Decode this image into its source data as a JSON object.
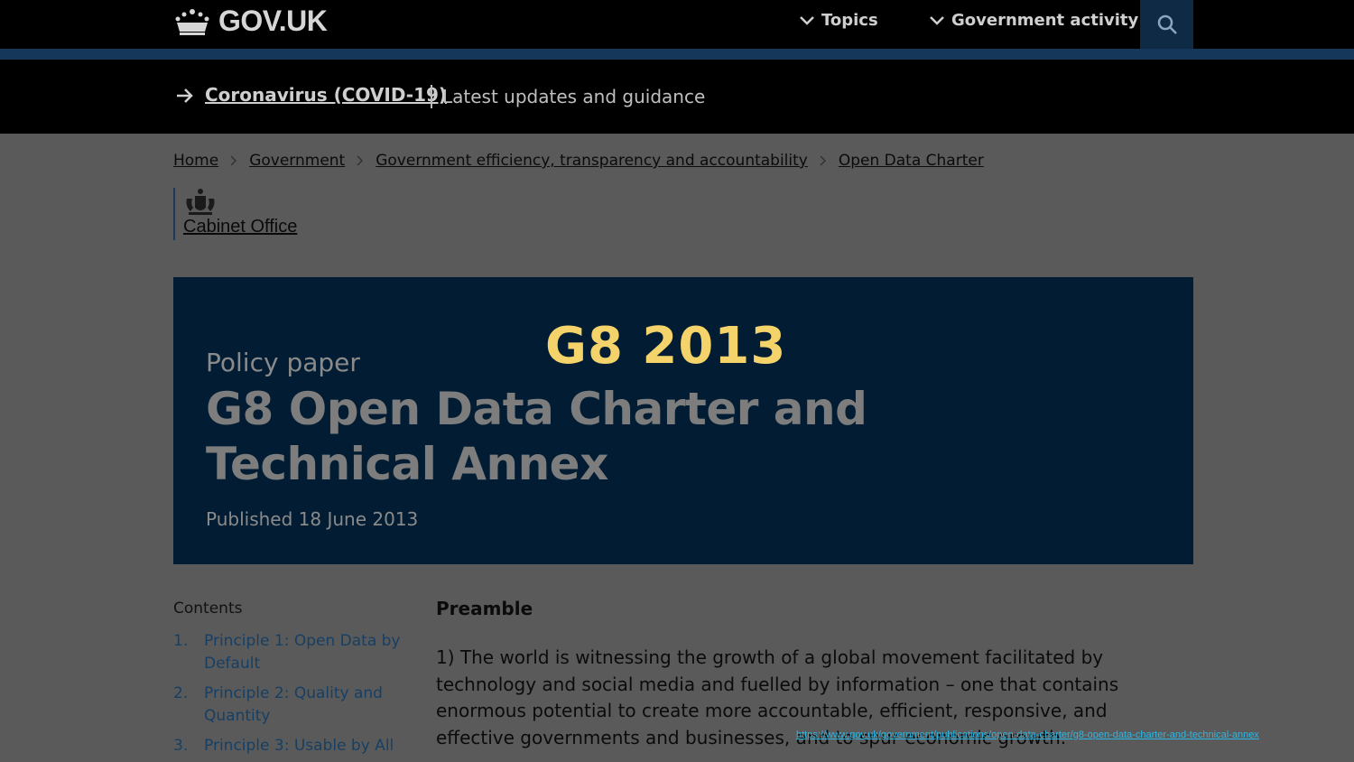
{
  "header": {
    "logo_text": "GOV.UK",
    "nav": [
      {
        "label": "Topics"
      },
      {
        "label": "Government activity"
      }
    ]
  },
  "covid_banner": {
    "link": "Coronavirus (COVID-19)",
    "text": "Latest updates and guidance"
  },
  "breadcrumb": [
    "Home",
    "Government",
    "Government efficiency, transparency and accountability",
    "Open Data Charter"
  ],
  "organisation": "Cabinet Office",
  "hero": {
    "overlay_title": "G8 2013",
    "document_type": "Policy paper",
    "title": "G8 Open Data Charter and Technical Annex",
    "published": "Published 18 June 2013"
  },
  "contents": {
    "title": "Contents",
    "items": [
      {
        "num": "1.",
        "label": "Principle 1: Open Data by Default"
      },
      {
        "num": "2.",
        "label": "Principle 2: Quality and Quantity"
      },
      {
        "num": "3.",
        "label": "Principle 3: Usable by All"
      }
    ]
  },
  "main": {
    "section_title": "Preamble",
    "paragraph": "1) The world is witnessing the growth of a global movement facilitated by technology and social media and fuelled by information – one that contains enormous potential to create more accountable, efficient, responsive, and effective governments and businesses, and to spur economic growth."
  },
  "source_url": "https://www.gov.uk/government/publications/open-data-charter/g8-open-data-charter-and-technical-annex",
  "colors": {
    "header_bg": "#000000",
    "hero_bg": "#021d33",
    "overlay_title": "#f5d36b",
    "link_blue": "#173f63"
  }
}
